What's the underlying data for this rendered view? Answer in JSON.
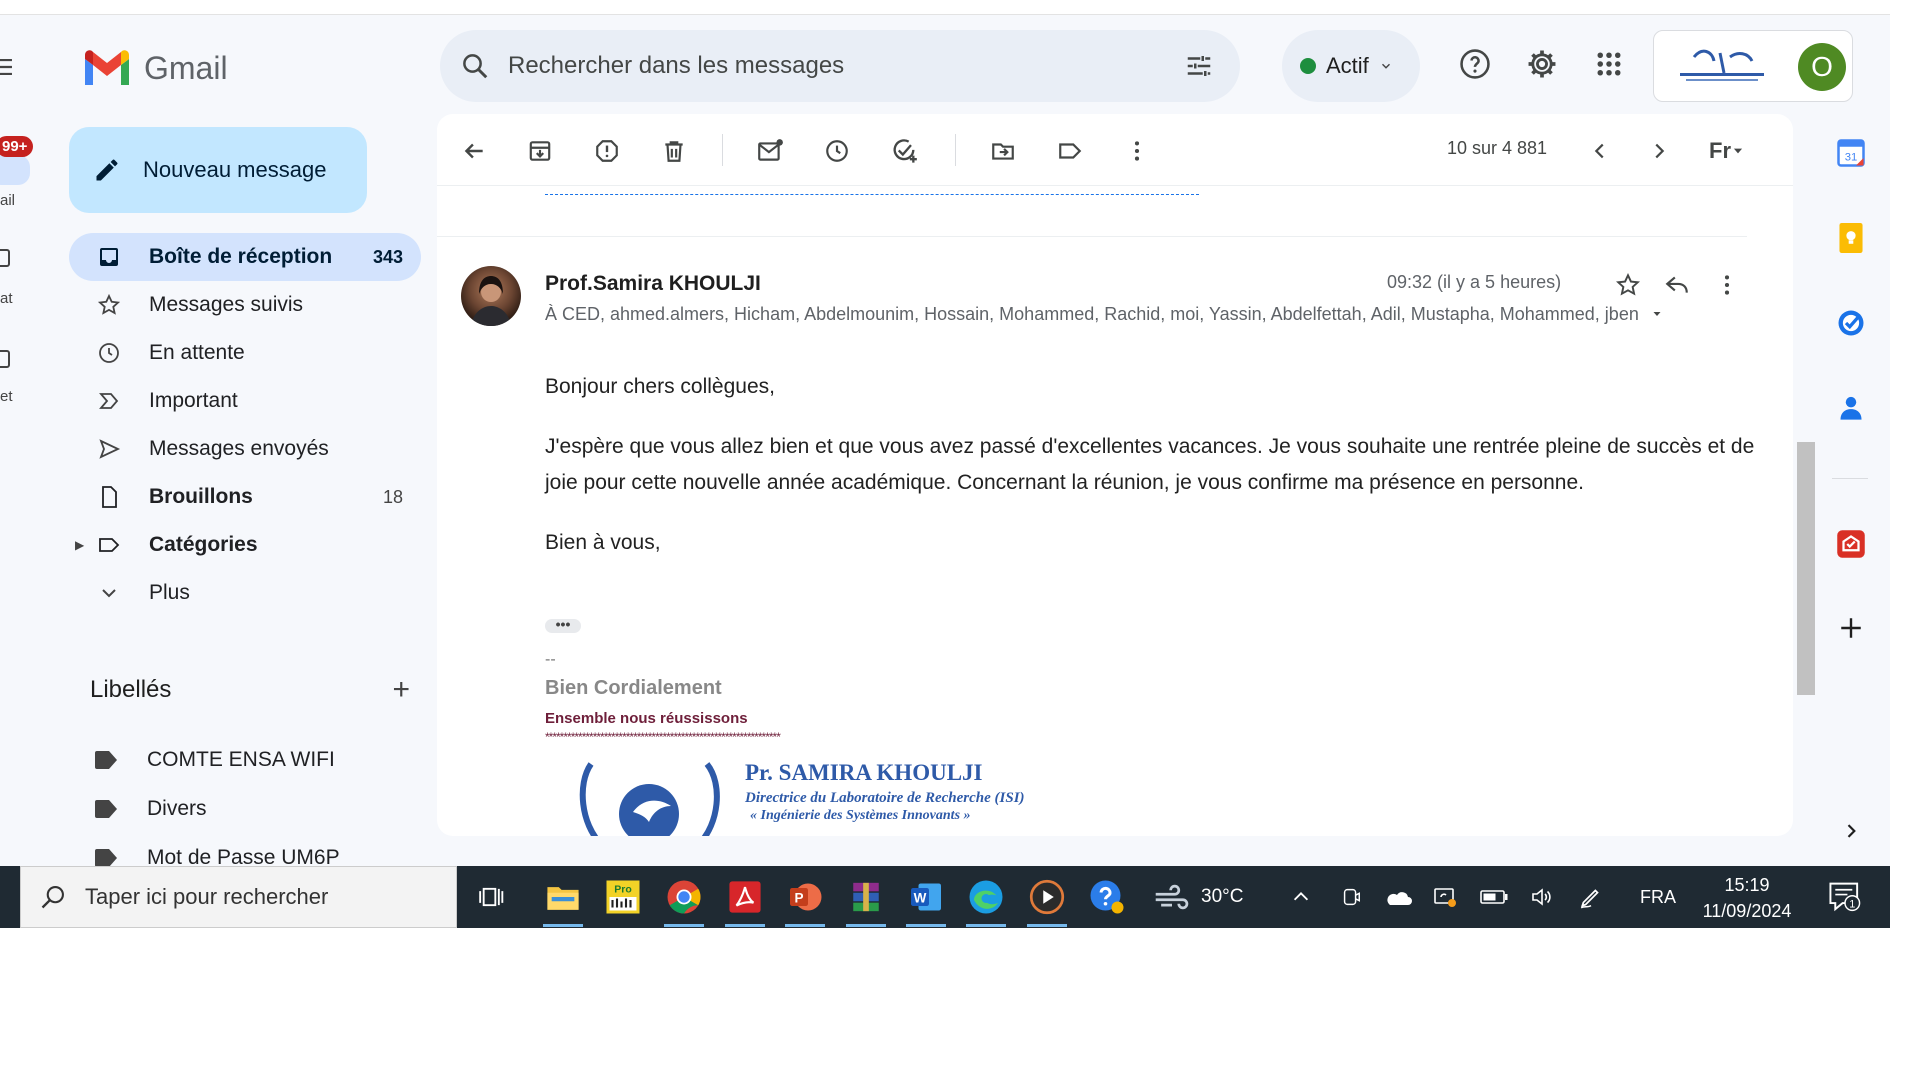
{
  "rail": {
    "badge": "99+",
    "labels": [
      "ail",
      "at",
      "et"
    ]
  },
  "sidebar": {
    "app_name": "Gmail",
    "compose_label": "Nouveau message",
    "nav": [
      {
        "label": "Boîte de réception",
        "count": "343",
        "icon": "inbox-icon"
      },
      {
        "label": "Messages suivis",
        "count": "",
        "icon": "star-icon"
      },
      {
        "label": "En attente",
        "count": "",
        "icon": "clock-icon"
      },
      {
        "label": "Important",
        "count": "",
        "icon": "important-icon"
      },
      {
        "label": "Messages envoyés",
        "count": "",
        "icon": "send-icon"
      },
      {
        "label": "Brouillons",
        "count": "18",
        "icon": "draft-icon"
      },
      {
        "label": "Catégories",
        "count": "",
        "icon": "label-outline-icon"
      },
      {
        "label": "Plus",
        "count": "",
        "icon": "chevron-down-icon"
      }
    ],
    "labels_title": "Libellés",
    "labels": [
      "COMTE ENSA WIFI",
      "Divers",
      "Mot de Passe UM6P"
    ]
  },
  "search": {
    "placeholder": "Rechercher dans les messages"
  },
  "status": {
    "label": "Actif",
    "color": "#1e8e3e"
  },
  "account": {
    "avatar_letter": "O",
    "avatar_color": "#4f8a23"
  },
  "toolbar": {
    "pager": "10 sur 4 881",
    "lang": "Fr"
  },
  "message": {
    "sender": "Prof.Samira KHOULJI",
    "recipients": "À CED, ahmed.almers, Hicham, Abdelmounim, Hossain, Mohammed, Rachid, moi, Yassin, Abdelfettah, Adil, Mustapha, Mohammed, jben",
    "time": "09:32 (il y a 5 heures)",
    "greeting": "Bonjour chers collègues,",
    "paragraph": "J'espère que vous allez bien et que vous avez passé d'excellentes vacances. Je vous souhaite une rentrée pleine de succès et de joie pour cette nouvelle année académique. Concernant la réunion, je vous confirme ma présence en personne.",
    "closing": "Bien à vous,",
    "signature": {
      "dash": "--",
      "name": "Bien Cordialement",
      "motto": "Ensemble nous réussissons",
      "stars": "****************************************************************",
      "title": "Pr. SAMIRA KHOULJI",
      "subtitle": "Directrice du Laboratoire de Recherche (ISI)",
      "subtitle2": "« Ingénierie des Systèmes Innovants »"
    }
  },
  "taskbar": {
    "search_placeholder": "Taper ici pour rechercher",
    "weather": "30°C",
    "lang": "FRA",
    "time": "15:19",
    "date": "11/09/2024",
    "notif_count": "1"
  }
}
